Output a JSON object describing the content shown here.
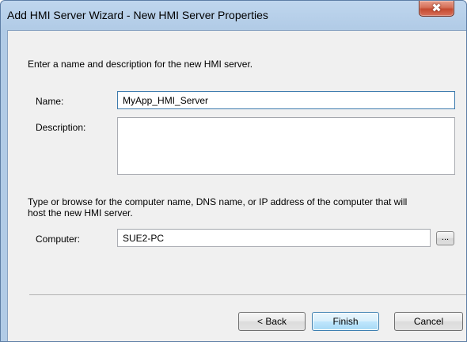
{
  "window": {
    "title": "Add HMI Server Wizard - New HMI Server Properties",
    "close_glyph": "✖"
  },
  "intro": {
    "text": "Enter a name and description for the new HMI server."
  },
  "name": {
    "label": "Name:",
    "value": "MyApp_HMI_Server"
  },
  "description": {
    "label": "Description:",
    "value": ""
  },
  "computer_hint": {
    "line1": "Type or browse for the computer name, DNS name, or IP address of the computer that will",
    "line2": "host the new HMI server."
  },
  "computer": {
    "label": "Computer:",
    "value": "SUE2-PC",
    "browse_label": "..."
  },
  "buttons": {
    "back": "< Back",
    "finish": "Finish",
    "cancel": "Cancel"
  },
  "colors": {
    "titlebar": "#bfd6ee",
    "client": "#f0f0f0",
    "close_button": "#c44a30",
    "focus_border": "#3d7bad",
    "default_button": "#3c7fb1"
  },
  "icons": {
    "close": "close-icon",
    "browse": "ellipsis-icon"
  }
}
